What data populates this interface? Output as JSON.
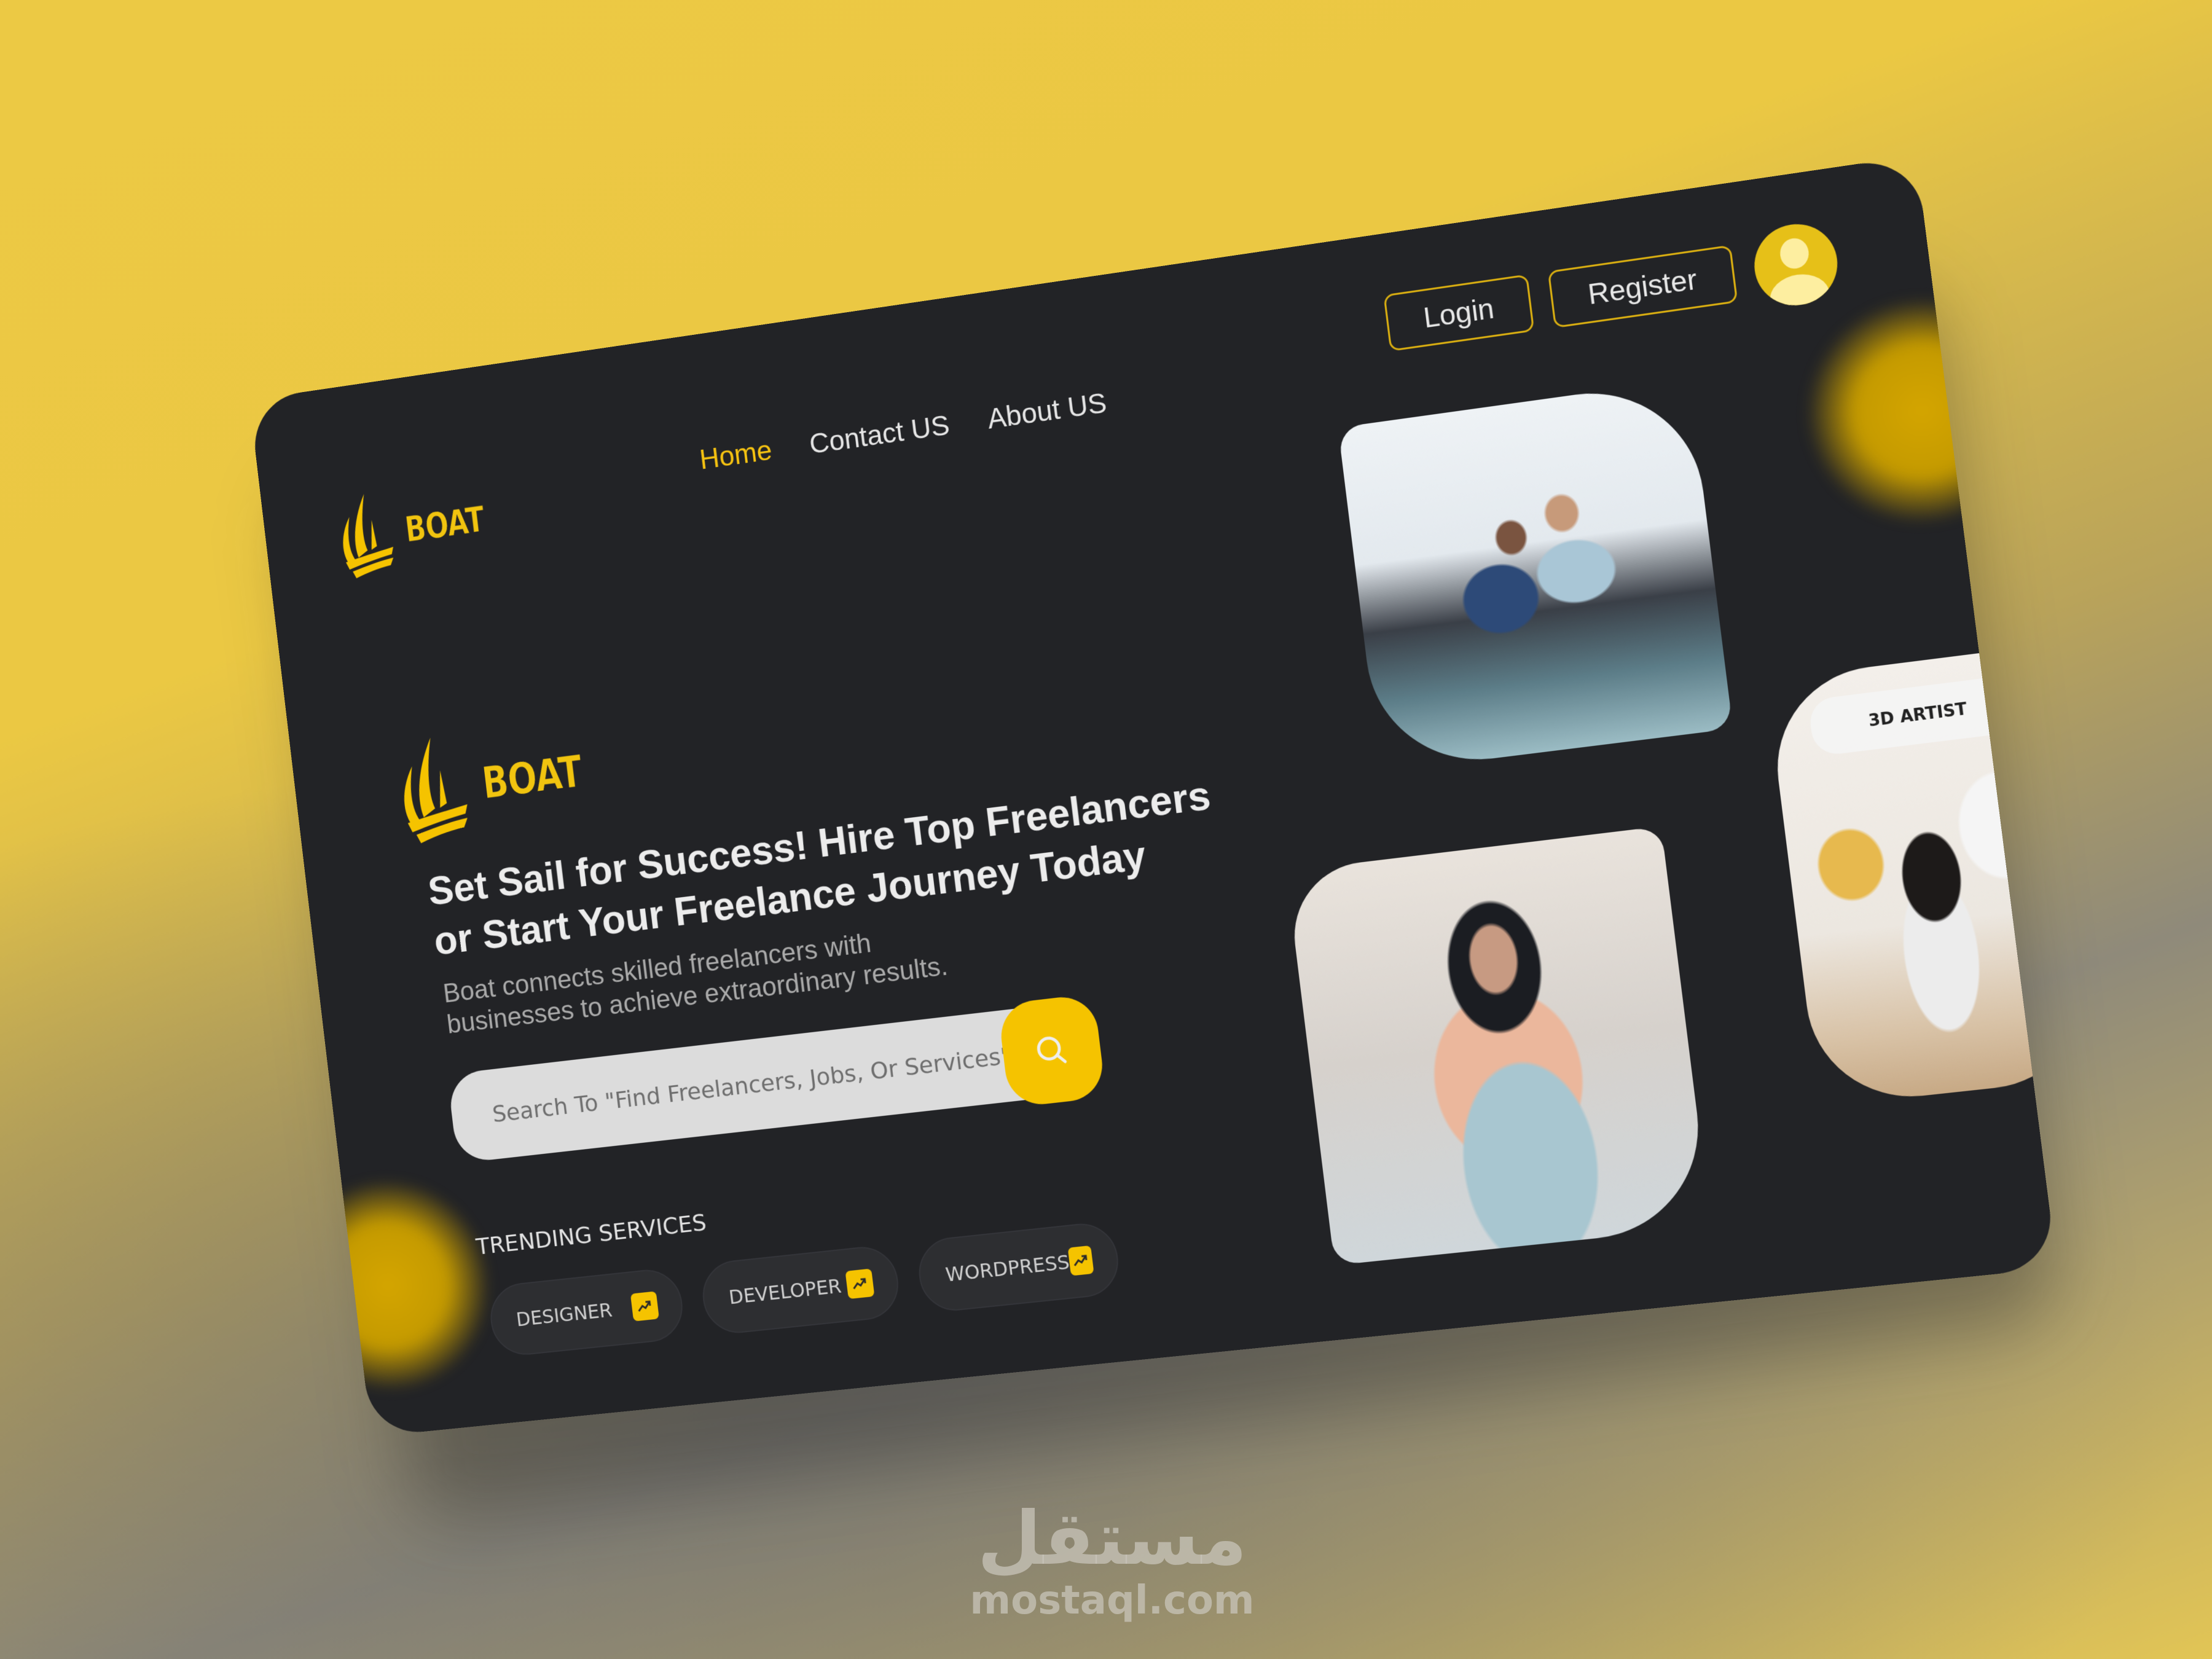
{
  "brand": {
    "name": "BOAT",
    "color_primary": "#F5C300",
    "color_surface": "#222326"
  },
  "nav": {
    "items": [
      {
        "label": "Home",
        "active": true
      },
      {
        "label": "Contact US",
        "active": false
      },
      {
        "label": "About US",
        "active": false
      }
    ]
  },
  "auth": {
    "login_label": "Login",
    "register_label": "Register",
    "avatar_icon": "user-avatar-icon"
  },
  "hero": {
    "title": "Set Sail for Success! Hire Top Freelancers or Start Your Freelance Journey Today",
    "subtitle": "Boat connects skilled freelancers with businesses to achieve extraordinary results.",
    "search": {
      "placeholder": "Search To \"Find Freelancers, Jobs, Or Services\"",
      "value": "",
      "button_icon": "search-icon"
    }
  },
  "trending": {
    "label": "TRENDING SERVICES",
    "items": [
      {
        "label": "DESIGNER",
        "icon": "trending-up-icon"
      },
      {
        "label": "DEVELOPER",
        "icon": "trending-up-icon"
      },
      {
        "label": "WORDPRESS",
        "icon": "trending-up-icon"
      }
    ]
  },
  "gallery": {
    "photos": [
      {
        "description": "Two businessmen laughing while looking at a laptop"
      },
      {
        "description": "Woman smiling while working on a laptop"
      },
      {
        "description": "Designer woman drawing on a graphics tablet",
        "badge": "3D ARTIST"
      }
    ]
  },
  "watermark": {
    "arabic": "مستقل",
    "latin": "mostaql.com"
  }
}
